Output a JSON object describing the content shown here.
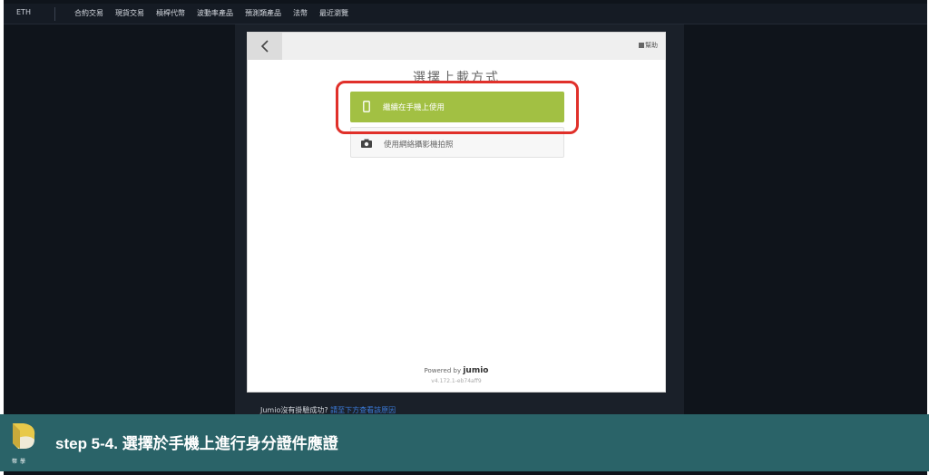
{
  "topnav": {
    "coin": "ETH",
    "items": [
      "合約交易",
      "現貨交易",
      "槓桿代幣",
      "波動率產品",
      "預測類產品",
      "法幣",
      "最近瀏覽"
    ]
  },
  "modal": {
    "help_label": "幫助",
    "title": "選擇上載方式",
    "options": [
      {
        "label": "繼續在手機上使用",
        "icon": "smartphone-icon"
      },
      {
        "label": "使用網絡攝影機拍照",
        "icon": "camera-icon"
      }
    ],
    "powered_by": "Powered by",
    "brand": "jumio",
    "version": "v4.172.1-eb74aff9"
  },
  "under_text": {
    "text": "Jumio沒有掛驗成功?",
    "link": "請至下方查看該原因"
  },
  "banner": {
    "logo_text": "幣學",
    "title": "step 5-4. 選擇於手機上進行身分證件應證"
  },
  "colors": {
    "accent_green": "#a2c043",
    "highlight_red": "#e0302a",
    "banner_teal": "#2a6368",
    "page_bg": "#0f141b"
  }
}
